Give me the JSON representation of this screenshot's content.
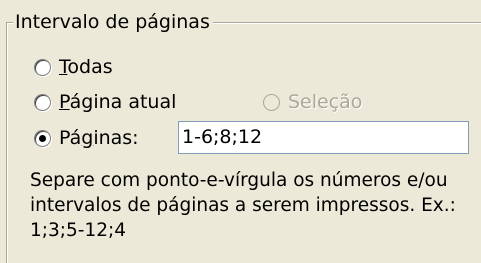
{
  "group": {
    "title": "Intervalo de páginas"
  },
  "options": [
    {
      "label_prefix": "",
      "accel": "T",
      "label_rest": "odas"
    },
    {
      "label_prefix": "",
      "accel": "P",
      "label_rest": "ágina atual"
    },
    {
      "label": "Seleção"
    },
    {
      "label_prefix": "Pá",
      "accel": "g",
      "label_rest": "inas:"
    }
  ],
  "pages_input": {
    "value": "1-6;8;12"
  },
  "help": {
    "line1": "Separe com ponto-e-vírgula os números e/ou",
    "line2": "intervalos de páginas a serem impressos.  Ex.:",
    "line3": "1;3;5-12;4"
  }
}
